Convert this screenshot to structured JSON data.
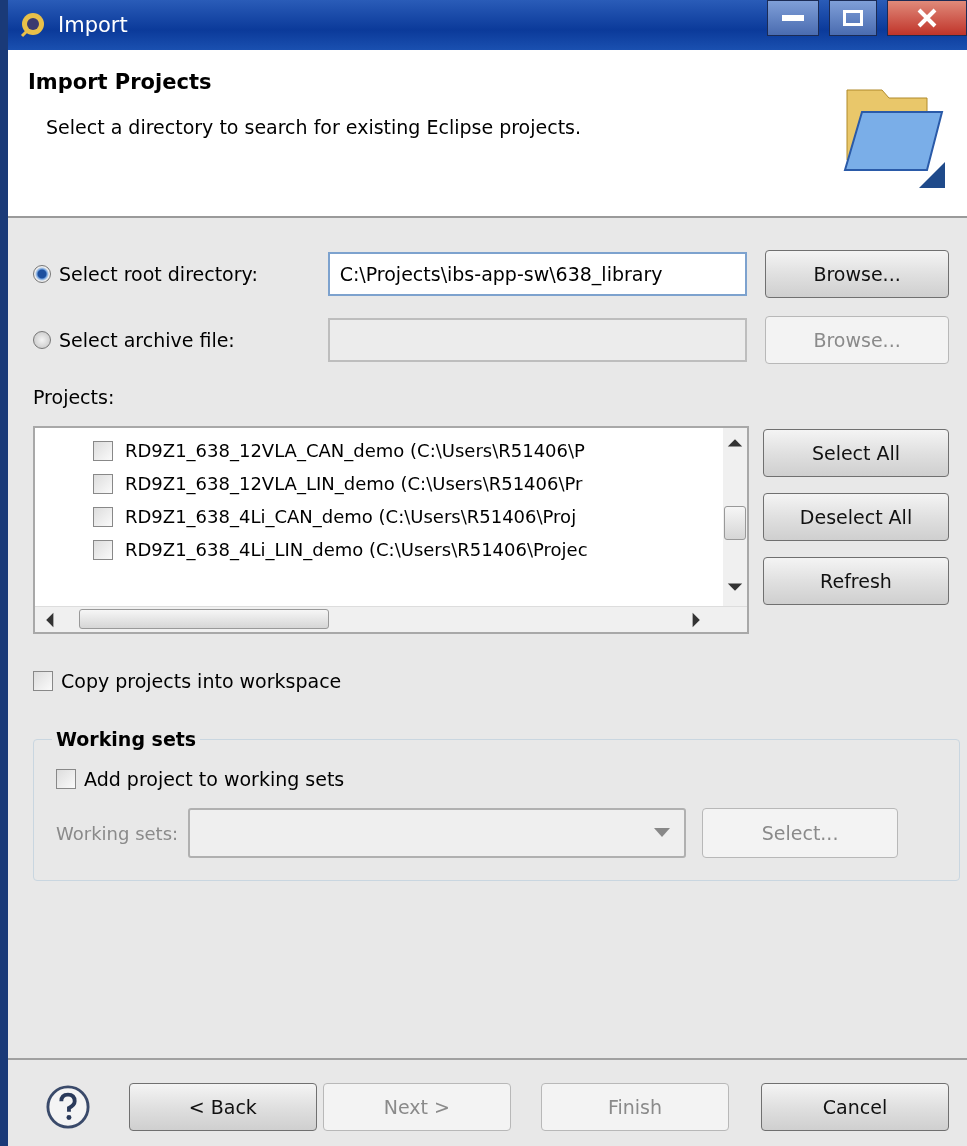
{
  "window": {
    "title": "Import"
  },
  "header": {
    "title": "Import Projects",
    "description": "Select a directory to search for existing Eclipse projects."
  },
  "source": [
    {
      "label": "Select root directory:",
      "selected": true,
      "value": "C:\\Projects\\ibs-app-sw\\638_library",
      "disabled": false,
      "browse": "Browse..."
    },
    {
      "label": "Select archive file:",
      "selected": false,
      "disabled": true,
      "browse": "Browse..."
    }
  ],
  "projects": {
    "label": "Projects:",
    "items": [
      {
        "label": "RD9Z1_638_12VLA_CAN_demo (C:\\Users\\R51406\\P",
        "checked": false
      },
      {
        "label": "RD9Z1_638_12VLA_LIN_demo (C:\\Users\\R51406\\Pr",
        "checked": false
      },
      {
        "label": "RD9Z1_638_4Li_CAN_demo (C:\\Users\\R51406\\Proj",
        "checked": false
      },
      {
        "label": "RD9Z1_638_4Li_LIN_demo (C:\\Users\\R51406\\Projec",
        "checked": false
      }
    ],
    "buttons": [
      "Select All",
      "Deselect All",
      "Refresh"
    ]
  },
  "copy_into_workspace": {
    "label": "Copy projects into workspace",
    "checked": false
  },
  "working_sets": {
    "title": "Working sets",
    "add": {
      "label": "Add project to working sets",
      "checked": false
    },
    "field_label": "Working sets:",
    "select": "Select...",
    "disabled": true
  },
  "footer": {
    "buttons": [
      {
        "label": "< Back",
        "disabled": false
      },
      {
        "label": "Next >",
        "disabled": true
      },
      {
        "label": "Finish",
        "disabled": true
      },
      {
        "label": "Cancel",
        "disabled": false
      }
    ]
  }
}
